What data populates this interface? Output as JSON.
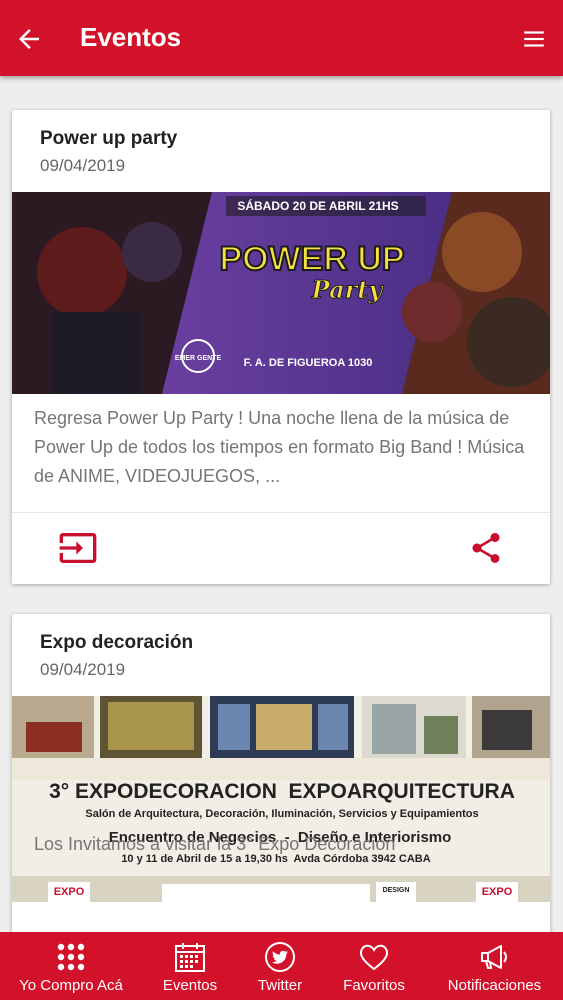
{
  "header": {
    "title": "Eventos"
  },
  "events": [
    {
      "title": "Power up party",
      "date": "09/04/2019",
      "description": "Regresa Power Up Party ! Una noche llena de la música de Power Up de todos los tiempos en formato Big Band ! Música de ANIME, VIDEOJUEGOS, ...",
      "poster": {
        "date_line": "SÁBADO 20 DE ABRIL 21HS",
        "brand": "POWER UP",
        "subtitle": "Party",
        "address": "F. A. DE FIGUEROA 1030",
        "venue_logo": "EMER GENTE"
      }
    },
    {
      "title": "Expo decoración",
      "date": "09/04/2019",
      "description": "Los Invitamos a visitar la 3° Expo Decoracion",
      "poster": {
        "headline": "3° EXPODECORACION  EXPOARQUITECTURA",
        "line2": "Salón de Arquitectura, Decoración, Iluminación, Servicios y Equipamientos",
        "line3": "Encuentro de Negocios  -  Diseño e Interiorismo",
        "line4": "10 y 11 de Abril de 15 a 19,30 hs  Avda Córdoba 3942 CABA",
        "logo_left": "EXPO",
        "logo_right": "EXPO",
        "logo_center": "DESIGN"
      }
    }
  ],
  "bottom_nav": [
    {
      "label": "Yo Compro Acá",
      "icon": "grid-dots-icon"
    },
    {
      "label": "Eventos",
      "icon": "calendar-icon"
    },
    {
      "label": "Twitter",
      "icon": "twitter-icon"
    },
    {
      "label": "Favoritos",
      "icon": "heart-icon"
    },
    {
      "label": "Notificaciones",
      "icon": "megaphone-icon"
    }
  ],
  "colors": {
    "primary": "#d2122b",
    "accent": "#c8102e"
  }
}
